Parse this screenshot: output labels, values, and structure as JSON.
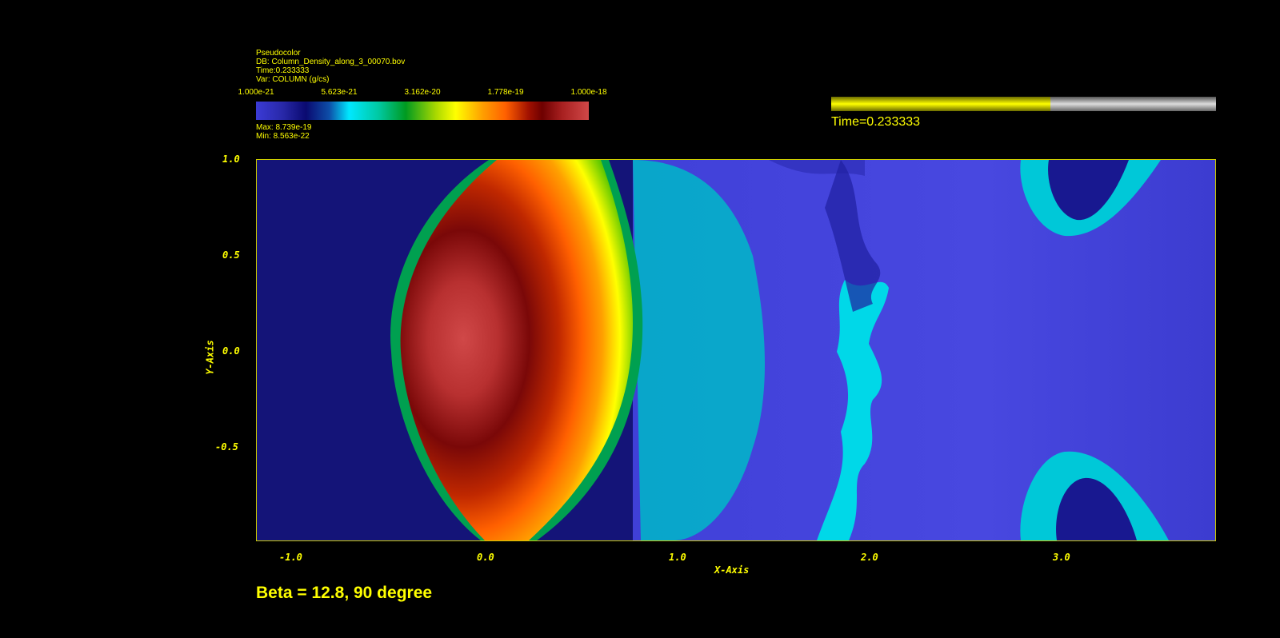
{
  "legend": {
    "plot_type": "Pseudocolor",
    "db": "DB: Column_Density_along_3_00070.bov",
    "time": "Time:0.233333",
    "var": "Var: COLUMN (g/cs)",
    "ticks": [
      "1.000e-21",
      "5.623e-21",
      "3.162e-20",
      "1.778e-19",
      "1.000e-18"
    ],
    "max": "Max:  8.739e-19",
    "min": "Min:  8.563e-22"
  },
  "time_slider": {
    "label": "Time=0.233333",
    "progress": 0.57
  },
  "colors": {
    "text": "#ffff00",
    "background": "#000000",
    "frame": "#cccc00"
  },
  "chart_data": {
    "type": "heatmap",
    "xlabel": "X-Axis",
    "ylabel": "Y-Axis",
    "xlim": [
      -1.2,
      3.8
    ],
    "ylim": [
      -1.0,
      1.0
    ],
    "xticks": [
      -1.0,
      0.0,
      1.0,
      2.0,
      3.0
    ],
    "xtick_labels": [
      "-1.0",
      "0.0",
      "1.0",
      "2.0",
      "3.0"
    ],
    "yticks": [
      1.0,
      0.5,
      0.0,
      -0.5
    ],
    "ytick_labels": [
      "1.0",
      "0.5",
      "0.0",
      "-0.5"
    ],
    "caption": "Beta = 12.8, 90 degree"
  }
}
